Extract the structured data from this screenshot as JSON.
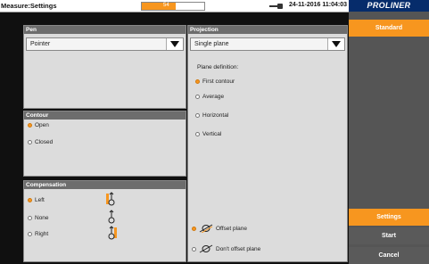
{
  "titlebar": {
    "title": "Measure:Settings",
    "progress_percent": 54,
    "progress_text": "54",
    "datetime": "24-11-2016 11:04:03",
    "logo": "PROLINER"
  },
  "pen": {
    "header": "Pen",
    "selected": "Pointer"
  },
  "contour": {
    "header": "Contour",
    "options": [
      {
        "label": "Open",
        "selected": true
      },
      {
        "label": "Closed",
        "selected": false
      }
    ]
  },
  "compensation": {
    "header": "Compensation",
    "options": [
      {
        "label": "Left",
        "selected": true,
        "icon": "probe-left-icon"
      },
      {
        "label": "None",
        "selected": false,
        "icon": "probe-none-icon"
      },
      {
        "label": "Right",
        "selected": false,
        "icon": "probe-right-icon"
      }
    ]
  },
  "projection": {
    "header": "Projection",
    "selected": "Single plane",
    "plane_definition_label": "Plane definition:",
    "plane_options": [
      {
        "label": "First contour",
        "selected": true
      },
      {
        "label": "Average",
        "selected": false
      },
      {
        "label": "Horizontal",
        "selected": false
      },
      {
        "label": "Vertical",
        "selected": false
      }
    ],
    "offset_options": [
      {
        "label": "Offset plane",
        "selected": true,
        "icon": "offset-plane-icon"
      },
      {
        "label": "Don't offset plane",
        "selected": false,
        "icon": "no-offset-plane-icon"
      }
    ]
  },
  "sidebar": {
    "standard": "Standard",
    "settings": "Settings",
    "start": "Start",
    "cancel": "Cancel"
  },
  "colors": {
    "accent": "#f7961f",
    "header_gray": "#6d6d6d",
    "sidebar_gray": "#555555",
    "logo_blue": "#062c6b"
  }
}
